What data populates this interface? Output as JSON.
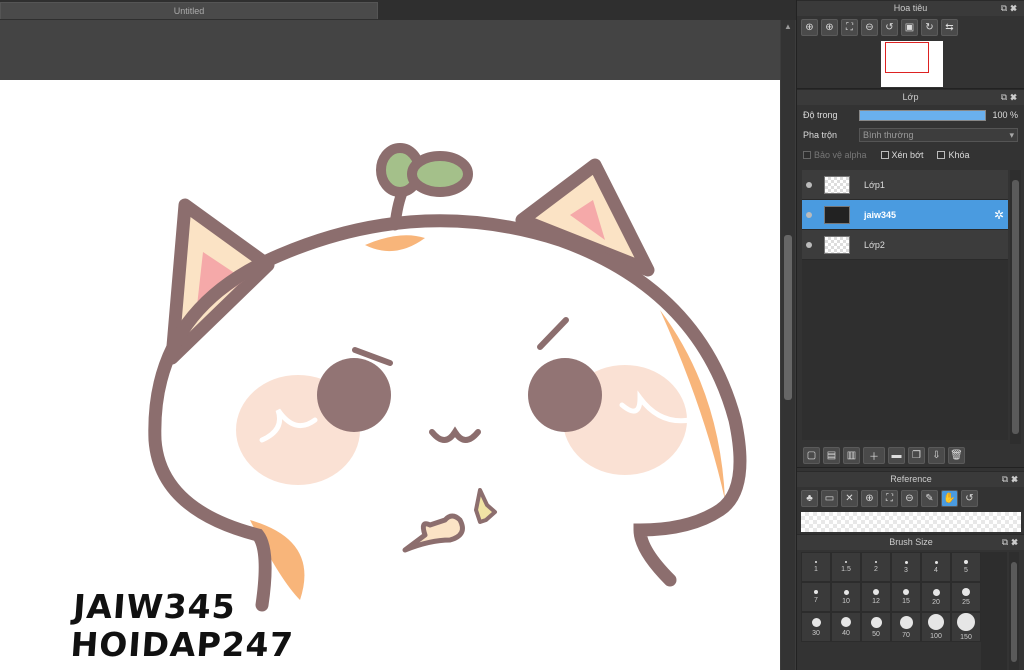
{
  "document": {
    "tab_title": "Untitled"
  },
  "watermark": {
    "line1": "JAIW345",
    "line2": "HOIDAP247"
  },
  "navigator": {
    "title": "Hoa tiêu",
    "tools": [
      "zoom-fit-icon",
      "zoom-in-icon",
      "fit-window-icon",
      "zoom-out-icon",
      "rotate-left-icon",
      "fullscreen-icon",
      "rotate-right-icon",
      "flip-icon"
    ]
  },
  "layer_panel": {
    "title": "Lớp",
    "opacity_label": "Độ trong",
    "opacity_value": "100 %",
    "opacity_fraction": 1.0,
    "blend_label": "Pha trộn",
    "blend_value": "Bình thường",
    "protect_alpha": "Bảo vệ alpha",
    "clipping": "Xén bớt",
    "lock": "Khóa",
    "layers": [
      {
        "name": "Lớp1",
        "selected": false
      },
      {
        "name": "jaiw345",
        "selected": true
      },
      {
        "name": "Lớp2",
        "selected": false
      }
    ],
    "tools": [
      "new-layer-icon",
      "new-raster-icon",
      "new-text-icon",
      "add-icon",
      "folder-icon",
      "duplicate-icon",
      "merge-icon",
      "delete-icon"
    ]
  },
  "reference": {
    "title": "Reference",
    "tools": [
      "tree-icon",
      "folder-open-icon",
      "close-icon",
      "zoom-in-icon",
      "fit-icon",
      "zoom-out-icon",
      "eyedropper-icon",
      "hand-icon",
      "rotate-icon"
    ]
  },
  "brush_size": {
    "title": "Brush Size",
    "sizes": [
      "1",
      "1.5",
      "2",
      "3",
      "4",
      "5",
      "7",
      "10",
      "12",
      "15",
      "20",
      "25",
      "30",
      "40",
      "50",
      "70",
      "100",
      "150"
    ]
  },
  "colors": {
    "accent": "#4a9be0",
    "panel": "#333333"
  }
}
